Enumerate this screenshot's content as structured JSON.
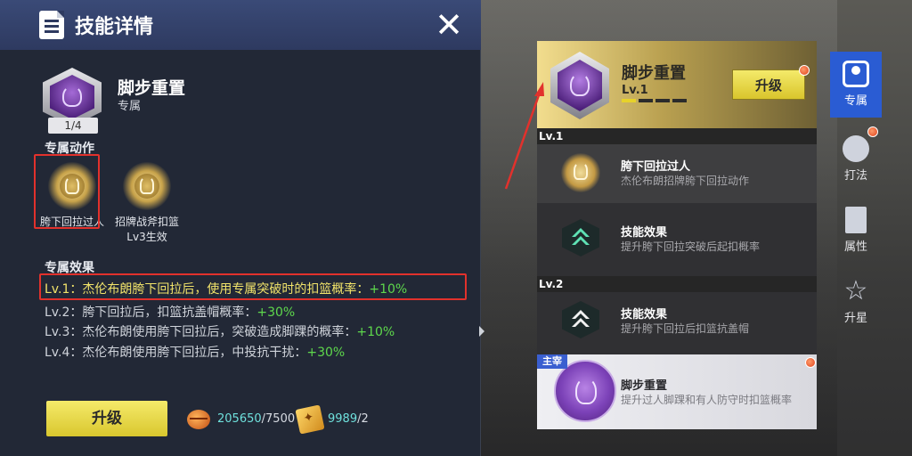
{
  "left_panel": {
    "title": "技能详情",
    "close_icon": "✕",
    "skill": {
      "name": "脚步重置",
      "tag": "专属",
      "count": "1/4"
    },
    "actions_title": "专属动作",
    "actions": [
      {
        "label": "胯下回拉过人",
        "sub": ""
      },
      {
        "label": "招牌战斧扣篮",
        "sub": "Lv3生效"
      }
    ],
    "effects_title": "专属效果",
    "effects": [
      {
        "text": "Lv.1：杰伦布朗胯下回拉后，使用专属突破时的扣篮概率：",
        "plus": "+10%"
      },
      {
        "text": "Lv.2：胯下回拉后，扣篮抗盖帽概率：",
        "plus": "+30%"
      },
      {
        "text": "Lv.3：杰伦布朗使用胯下回拉后，突破造成脚踝的概率：",
        "plus": "+10%"
      },
      {
        "text": "Lv.4：杰伦布朗使用胯下回拉后，中投抗干扰：",
        "plus": "+30%"
      }
    ],
    "upgrade_label": "升级",
    "resources": [
      {
        "icon": "basketball-icon",
        "have": "205650",
        "need": "/7500"
      },
      {
        "icon": "skill-card-icon",
        "have": "9989",
        "need": "/2"
      }
    ]
  },
  "right_list": {
    "header": {
      "name": "脚步重置",
      "level": "Lv.1",
      "progress_segments": 4,
      "progress_filled": 1,
      "upgrade_label": "升级"
    },
    "level_bands": [
      "Lv.1",
      "Lv.2"
    ],
    "rows": [
      {
        "icon": "dribble-move-icon",
        "title": "胯下回拉过人",
        "desc": "杰伦布朗招牌胯下回拉动作"
      },
      {
        "icon": "skill-effect-green-icon",
        "title": "技能效果",
        "desc": "提升胯下回拉突破后起扣概率"
      },
      {
        "icon": "skill-effect-white-icon",
        "title": "技能效果",
        "desc": "提升胯下回拉后扣篮抗盖帽"
      }
    ],
    "main_row": {
      "tag": "主宰",
      "title": "脚步重置",
      "desc": "提升过人脚踝和有人防守时扣篮概率"
    }
  },
  "tabs": [
    {
      "label": "专属",
      "icon": "exclusive-icon",
      "active": true
    },
    {
      "label": "打法",
      "icon": "playstyle-icon",
      "active": false
    },
    {
      "label": "属性",
      "icon": "attributes-icon",
      "active": false
    },
    {
      "label": "升星",
      "icon": "star-up-icon",
      "active": false
    }
  ],
  "colors": {
    "accent_blue": "#2a5cd3",
    "button_yellow": "#f5ea6a",
    "plus_green": "#5ed84c",
    "highlight_yellow": "#f1e36a",
    "annotation_red": "#e2312c"
  }
}
